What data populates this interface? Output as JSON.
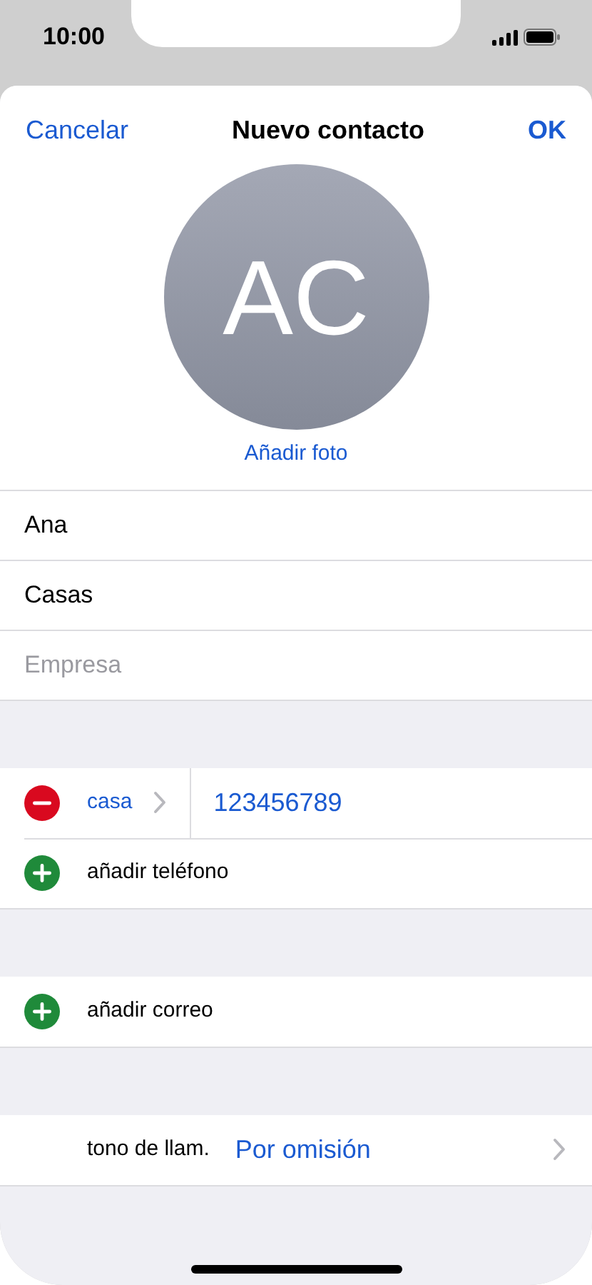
{
  "status_bar": {
    "time": "10:00"
  },
  "nav": {
    "cancel": "Cancelar",
    "title": "Nuevo contacto",
    "done": "OK"
  },
  "avatar": {
    "initials": "AC",
    "action": "Añadir foto"
  },
  "name_fields": [
    {
      "value": "Ana"
    },
    {
      "value": "Casas"
    },
    {
      "placeholder": "Empresa"
    }
  ],
  "sections": [
    {
      "rows": [
        {
          "kind": "phone",
          "label": "casa",
          "value": "123456789"
        },
        {
          "kind": "add",
          "label": "añadir teléfono"
        }
      ]
    },
    {
      "rows": [
        {
          "kind": "add",
          "label": "añadir correo"
        }
      ]
    },
    {
      "rows": [
        {
          "kind": "setting",
          "label": "tono de llam.",
          "value": "Por omisión"
        }
      ]
    }
  ]
}
